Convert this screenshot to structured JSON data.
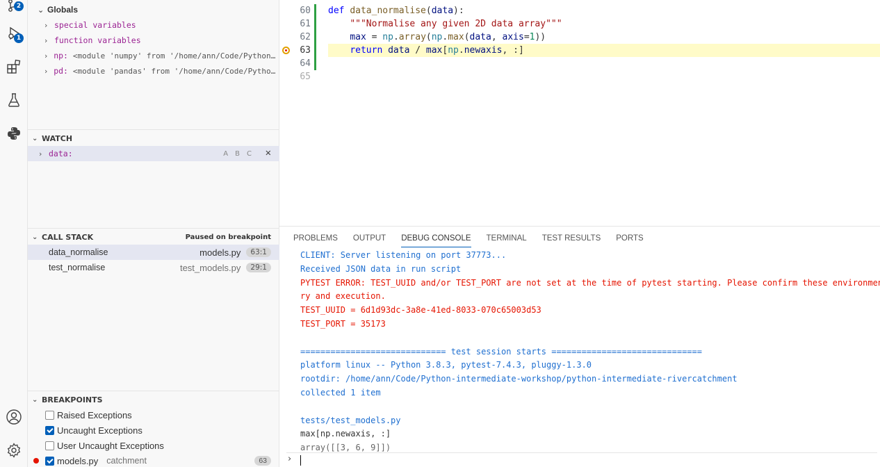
{
  "activity_bar": {
    "source_control_badge": "2",
    "debug_badge": "1"
  },
  "variables": {
    "globals_label": "Globals",
    "rows": [
      {
        "name": "special variables",
        "value": ""
      },
      {
        "name": "function variables",
        "value": ""
      },
      {
        "name": "np:",
        "value": "<module 'numpy' from '/home/ann/Code/Python-..."
      },
      {
        "name": "pd:",
        "value": "<module 'pandas' from '/home/ann/Code/Python..."
      }
    ]
  },
  "watch": {
    "title": "WATCH",
    "expression": "data:",
    "actions": [
      "A",
      "B",
      "C"
    ],
    "close": "✕"
  },
  "call_stack": {
    "title": "CALL STACK",
    "status": "Paused on breakpoint",
    "frames": [
      {
        "function": "data_normalise",
        "file": "models.py",
        "position": "63:1"
      },
      {
        "function": "test_normalise",
        "file": "test_models.py",
        "position": "29:1"
      }
    ]
  },
  "breakpoints": {
    "title": "BREAKPOINTS",
    "items": [
      {
        "label": "Raised Exceptions",
        "checked": false
      },
      {
        "label": "Uncaught Exceptions",
        "checked": true
      },
      {
        "label": "User Uncaught Exceptions",
        "checked": false
      }
    ],
    "file_breakpoint": {
      "file": "models.py",
      "dir": "catchment",
      "line": "63",
      "checked": true
    }
  },
  "editor": {
    "line_numbers": [
      "60",
      "61",
      "62",
      "63",
      "64",
      "65"
    ]
  },
  "panel": {
    "tabs": [
      "PROBLEMS",
      "OUTPUT",
      "DEBUG CONSOLE",
      "TERMINAL",
      "TEST RESULTS",
      "PORTS"
    ],
    "active_tab": "DEBUG CONSOLE",
    "console_lines": [
      {
        "text": "CLIENT: Server listening on port 37773...",
        "color": "blue"
      },
      {
        "text": "Received JSON data in run script",
        "color": "blue"
      },
      {
        "text": "PYTEST ERROR: TEST_UUID and/or TEST_PORT are not set at the time of pytest starting. Please confirm these environment va",
        "color": "red"
      },
      {
        "text": "ry and execution.",
        "color": "red"
      },
      {
        "text": "TEST_UUID = 6d1d93dc-3a8e-41ed-8033-070c65003d53",
        "color": "red"
      },
      {
        "text": "TEST_PORT = 35173",
        "color": "red"
      },
      {
        "text": "",
        "color": "blue"
      },
      {
        "text": "============================= test session starts ==============================",
        "color": "blue"
      },
      {
        "text": "platform linux -- Python 3.8.3, pytest-7.4.3, pluggy-1.3.0",
        "color": "blue"
      },
      {
        "text": "rootdir: /home/ann/Code/Python-intermediate-workshop/python-intermediate-rivercatchment",
        "color": "blue"
      },
      {
        "text": "collected 1 item",
        "color": "blue"
      },
      {
        "text": "",
        "color": "blue"
      },
      {
        "text": "tests/test_models.py",
        "color": "blue"
      },
      {
        "text": "max[np.newaxis, :]",
        "color": "dark"
      },
      {
        "text": "array([[3, 6, 9]])",
        "color": "grey"
      }
    ]
  },
  "colors": {
    "accent": "#005fb8",
    "breakpoint": "#e51400",
    "current_line": "#fffbc8",
    "modified_gutter": "#2ea043"
  }
}
